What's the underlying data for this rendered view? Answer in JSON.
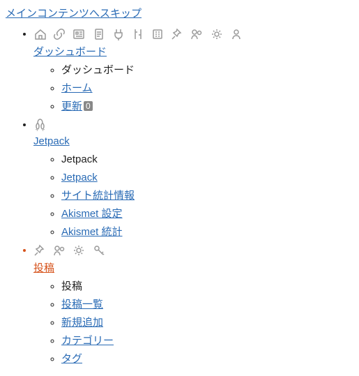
{
  "skip_link": "メインコンテンツへスキップ",
  "menu": [
    {
      "label": "ダッシュボード",
      "current": false,
      "icons": [
        "home",
        "link",
        "gallery",
        "page",
        "plugin",
        "tools",
        "pref",
        "pin",
        "users",
        "settings",
        "person"
      ],
      "sub": [
        {
          "label": "ダッシュボード",
          "link": false
        },
        {
          "label": "ホーム",
          "link": true
        },
        {
          "label": "更新",
          "link": true,
          "badge": "0"
        }
      ]
    },
    {
      "label": "Jetpack",
      "current": false,
      "icons": [
        "jetpack"
      ],
      "sub": [
        {
          "label": "Jetpack",
          "link": false
        },
        {
          "label": "Jetpack",
          "link": true
        },
        {
          "label": "サイト統計情報",
          "link": true
        },
        {
          "label": "Akismet 設定",
          "link": true
        },
        {
          "label": "Akismet 統計",
          "link": true
        }
      ]
    },
    {
      "label": "投稿",
      "current": true,
      "icons": [
        "pin",
        "users",
        "settings",
        "key"
      ],
      "sub": [
        {
          "label": "投稿",
          "link": false
        },
        {
          "label": "投稿一覧",
          "link": true
        },
        {
          "label": "新規追加",
          "link": true
        },
        {
          "label": "カテゴリー",
          "link": true
        },
        {
          "label": "タグ",
          "link": true
        }
      ]
    }
  ]
}
